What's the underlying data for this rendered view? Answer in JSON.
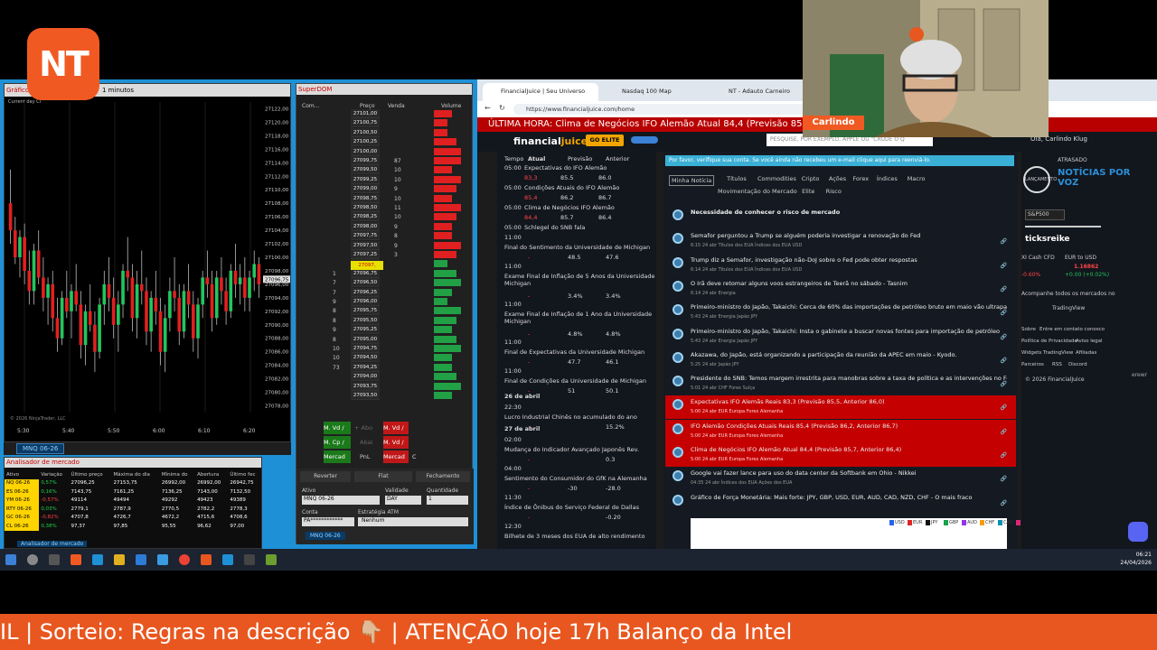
{
  "brand": {
    "logo_text": "NT",
    "accent": "#f05a22"
  },
  "chart": {
    "title": "Gráfico",
    "timeframe": "1 minutos",
    "label": "Current day Cl",
    "copyright": "© 2026 NinjaTrader, LLC",
    "price_labels": [
      "27122,00",
      "27120,00",
      "27118,00",
      "27116,00",
      "27114,00",
      "27112,00",
      "27110,00",
      "27108,00",
      "27106,00",
      "27104,00",
      "27102,00",
      "27100,00",
      "27098,00",
      "27096,00",
      "27094,00",
      "27092,00",
      "27090,00",
      "27088,00",
      "27086,00",
      "27084,00",
      "27082,00",
      "27080,00",
      "27078,00"
    ],
    "current_price": "27096,75",
    "time_labels": [
      "5:30",
      "5:40",
      "5:50",
      "6:00",
      "6:10",
      "6:20"
    ],
    "tab": "MNQ 06-26"
  },
  "chart_data": {
    "type": "candlestick",
    "ylim": [
      27077,
      27123
    ],
    "candles": [
      [
        27108,
        27113,
        27102,
        27104
      ],
      [
        27104,
        27106,
        27099,
        27100
      ],
      [
        27100,
        27104,
        27097,
        27103
      ],
      [
        27103,
        27105,
        27096,
        27098
      ],
      [
        27098,
        27101,
        27093,
        27095
      ],
      [
        27095,
        27102,
        27093,
        27101
      ],
      [
        27101,
        27104,
        27096,
        27097
      ],
      [
        27097,
        27100,
        27092,
        27094
      ],
      [
        27094,
        27097,
        27090,
        27096
      ],
      [
        27096,
        27098,
        27089,
        27091
      ],
      [
        27091,
        27094,
        27086,
        27088
      ],
      [
        27088,
        27095,
        27087,
        27094
      ],
      [
        27094,
        27098,
        27091,
        27092
      ],
      [
        27092,
        27096,
        27088,
        27095
      ],
      [
        27095,
        27099,
        27092,
        27093
      ],
      [
        27093,
        27095,
        27085,
        27087
      ],
      [
        27087,
        27093,
        27084,
        27092
      ],
      [
        27092,
        27096,
        27089,
        27090
      ],
      [
        27090,
        27092,
        27083,
        27086
      ],
      [
        27086,
        27094,
        27085,
        27093
      ],
      [
        27093,
        27098,
        27090,
        27096
      ],
      [
        27096,
        27100,
        27092,
        27094
      ],
      [
        27094,
        27097,
        27088,
        27090
      ],
      [
        27090,
        27095,
        27086,
        27093
      ],
      [
        27093,
        27099,
        27091,
        27098
      ],
      [
        27098,
        27103,
        27095,
        27097
      ],
      [
        27097,
        27099,
        27089,
        27091
      ],
      [
        27091,
        27098,
        27088,
        27096
      ],
      [
        27096,
        27101,
        27093,
        27095
      ],
      [
        27095,
        27097,
        27087,
        27089
      ],
      [
        27089,
        27095,
        27086,
        27094
      ],
      [
        27094,
        27098,
        27090,
        27092
      ],
      [
        27092,
        27094,
        27084,
        27086
      ],
      [
        27086,
        27093,
        27083,
        27091
      ],
      [
        27091,
        27097,
        27089,
        27095
      ],
      [
        27095,
        27100,
        27092,
        27094
      ],
      [
        27094,
        27096,
        27087,
        27089
      ],
      [
        27089,
        27096,
        27088,
        27095
      ],
      [
        27095,
        27099,
        27091,
        27093
      ],
      [
        27093,
        27095,
        27086,
        27088
      ],
      [
        27088,
        27094,
        27085,
        27093
      ],
      [
        27093,
        27098,
        27091,
        27097
      ],
      [
        27097,
        27101,
        27094,
        27096
      ],
      [
        27096,
        27098,
        27089,
        27091
      ],
      [
        27091,
        27098,
        27090,
        27097
      ],
      [
        27097,
        27100,
        27093,
        27095
      ],
      [
        27095,
        27097,
        27090,
        27092
      ],
      [
        27092,
        27099,
        27091,
        27098
      ],
      [
        27098,
        27102,
        27094,
        27096
      ],
      [
        27096,
        27099,
        27093,
        27097
      ],
      [
        27097,
        27100,
        27092,
        27094
      ],
      [
        27094,
        27098,
        27092,
        27097
      ],
      [
        27097,
        27101,
        27095,
        27099
      ],
      [
        27099,
        27100,
        27094,
        27096
      ]
    ]
  },
  "superdom": {
    "title": "SuperDOM",
    "headers": [
      "Com...",
      "Preço",
      "Venda",
      "Volume"
    ],
    "prices": [
      "27101,00",
      "27100,75",
      "27100,50",
      "27100,25",
      "27100,00",
      "27099,75",
      "27099,50",
      "27099,25",
      "27099,00",
      "27098,75",
      "27098,50",
      "27098,25",
      "27098,00",
      "27097,75",
      "27097,50",
      "27097,25",
      "27097,00",
      "27096,75",
      "27096,50",
      "27096,25",
      "27096,00",
      "27095,75",
      "27095,50",
      "27095,25",
      "27095,00",
      "27094,75",
      "27094,50",
      "27094,25",
      "27094,00",
      "27093,75",
      "27093,50"
    ],
    "sell": [
      "",
      "",
      "",
      "",
      "",
      "87",
      "10",
      "10",
      "9",
      "10",
      "11",
      "10",
      "9",
      "8",
      "9",
      "3",
      "",
      "",
      "",
      "",
      "",
      "",
      "",
      "",
      "",
      "",
      "",
      "",
      "",
      "",
      ""
    ],
    "buy": [
      "",
      "",
      "",
      "",
      "",
      "",
      "",
      "",
      "",
      "",
      "",
      "",
      "",
      "",
      "",
      "",
      "",
      "1",
      "7",
      "7",
      "9",
      "8",
      "8",
      "9",
      "8",
      "10",
      "10",
      "73",
      "",
      "",
      ""
    ],
    "highlight_price": "27097,",
    "highlight_qty": "3",
    "buttons": {
      "mkt_sell1": "M. Vd /",
      "above": "+ Abo",
      "mkt_buy": "M. Cp /",
      "below": "Abai",
      "market": "Mercad",
      "pnl": "PnL",
      "mkt_sell2": "M. Vd /",
      "mkt_sell3": "Mercad",
      "c": "C"
    },
    "reverse": "Reverter",
    "flat": "Flat",
    "close": "Fechamento",
    "ativo_label": "Ativo",
    "ativo_value": "MNQ 06-26",
    "validade_label": "Validade",
    "validade_value": "DAY",
    "qty_label": "Quantidade",
    "qty_value": "1",
    "conta_label": "Conta",
    "conta_value": "PA************",
    "atm_label": "Estratégia ATM",
    "atm_value": "Nenhum",
    "tab": "MNQ 06-26"
  },
  "analyzer": {
    "title": "Analisador de mercado",
    "headers": [
      "Ativo",
      "Variação",
      "Último preço",
      "Máxima do dia",
      "Mínima do",
      "Abertura",
      "Último fec"
    ],
    "rows": [
      [
        "NQ 06-26",
        "0,57%",
        "27096,25",
        "27153,75",
        "26992,00",
        "26992,00",
        "26942,75"
      ],
      [
        "ES 06-26",
        "0,16%",
        "7143,75",
        "7161,25",
        "7136,25",
        "7143,00",
        "7132,50"
      ],
      [
        "YM 06-26",
        "-0,57%",
        "49114",
        "49494",
        "49292",
        "49423",
        "49389"
      ],
      [
        "RTY 06-26",
        "0,03%",
        "2779,1",
        "2787,9",
        "2770,5",
        "2782,2",
        "2778,3"
      ],
      [
        "GC 06-26",
        "-0,82%",
        "4707,8",
        "4726,7",
        "4672,2",
        "4715,6",
        "4708,6"
      ],
      [
        "CL 06-26",
        "0,38%",
        "97,37",
        "97,85",
        "95,55",
        "96,62",
        "97,00"
      ]
    ],
    "tab": "Analisador de mercado"
  },
  "browser": {
    "tabs": [
      "FinancialJuice | Seu Universo Fina",
      "Nasdaq 100 Map",
      "NT - Adauto Carneiro"
    ],
    "url": "https://www.financialjuice.com/home",
    "breaking": "ÚLTIMA HORA: Clima de Negócios IFO Alemão Atual 84,4 (Previsão 85,7, Anterior 86,4)",
    "logo_a": "financial",
    "logo_b": "juice",
    "go_elite": "GO ELITE",
    "search_placeholder": "PESQUISE, POR EXEMPLO, APPLE OU \"CRUDE O Q",
    "user": "Olá, Carlindo Klug",
    "cal_headers": [
      "Tempo",
      "Atual",
      "Previsão",
      "Anterior"
    ],
    "cal_events": [
      {
        "time": "05:00",
        "name": "Expectativas do IFO Alemão",
        "atual": "83,3",
        "prev": "85.5",
        "ant": "86.0"
      },
      {
        "time": "05:00",
        "name": "Condições Atuais do IFO Alemão",
        "atual": "85,4",
        "prev": "86.2",
        "ant": "86.7"
      },
      {
        "time": "05:00",
        "name": "Clima de Negócios IFO Alemão",
        "atual": "84,4",
        "prev": "85.7",
        "ant": "86.4"
      },
      {
        "time": "05:00",
        "name": "Schlegel do SNB fala",
        "atual": "",
        "prev": "",
        "ant": ""
      },
      {
        "time": "11:00",
        "name": "Final do Sentimento da Universidade de Michigan",
        "atual": "-",
        "prev": "48.5",
        "ant": "47.6"
      },
      {
        "time": "11:00",
        "name": "Exame Final de Inflação de 5 Anos da Universidade Michigan",
        "atual": "-",
        "prev": "3.4%",
        "ant": "3.4%"
      },
      {
        "time": "11:00",
        "name": "Exame Final de Inflação de 1 Ano da Universidade Michigan",
        "atual": "-",
        "prev": "4.8%",
        "ant": "4.8%"
      },
      {
        "time": "11:00",
        "name": "Final de Expectativas da Universidade Michigan",
        "atual": "-",
        "prev": "47.7",
        "ant": "46.1"
      },
      {
        "time": "11:00",
        "name": "Final de Condições da Universidade de Michigan",
        "atual": "-",
        "prev": "51",
        "ant": "50.1"
      }
    ],
    "day2": "26 de abril",
    "day2_event": {
      "time": "22:30",
      "name": "Lucro Industrial Chinês no acumulado do ano",
      "atual": "-",
      "prev": "",
      "ant": "15.2%"
    },
    "day3": "27 de abril",
    "day3_events": [
      {
        "time": "02:00",
        "name": "Mudança do Indicador Avançado Japonês Rev.",
        "atual": "-",
        "prev": "",
        "ant": "0.3"
      },
      {
        "time": "04:00",
        "name": "Sentimento do Consumidor do GfK na Alemanha",
        "atual": "-",
        "prev": "-30",
        "ant": "-28.0"
      },
      {
        "time": "11:30",
        "name": "Índice de Ônibus do Serviço Federal de Dallas",
        "atual": "-",
        "prev": "",
        "ant": "-0.20"
      },
      {
        "time": "12:30",
        "name": "Bilhete de 3 meses dos EUA de alto rendimento",
        "atual": "",
        "prev": "",
        "ant": ""
      }
    ],
    "verify_msg": "Por favor, verifique sua conta. Se você ainda não recebeu um e-mail clique aqui para reenviá-lo.",
    "news_tabs": [
      "Minha Notícia",
      "Títulos",
      "Commodities",
      "Cripto",
      "Ações",
      "Forex",
      "Índices",
      "Macro",
      "Movimentação do Mercado",
      "Elite",
      "Risco"
    ],
    "news": [
      {
        "title": "Necessidade de conhecer o risco de mercado",
        "meta": "",
        "red": false
      },
      {
        "title": "Semafor perguntou a Trump se alguém poderia investigar a renovação do Fed",
        "meta": "6:15 24 abr  Títulos dos EUA  Índices dos EUA  USD",
        "red": false
      },
      {
        "title": "Trump diz a Semafor, investigação não-DoJ sobre o Fed pode obter respostas",
        "meta": "6:14 24 abr  Títulos dos EUA  Índices dos EUA  USD",
        "red": false
      },
      {
        "title": "O Irã deve retomar alguns voos estrangeiros de Teerã no sábado - Tasnim",
        "meta": "6:14 24 abr  Energia",
        "red": false
      },
      {
        "title": "Primeiro-ministro do Japão, Takaichi: Cerca de 60% das importações de petróleo bruto em maio vão ultrapassar Ormuz",
        "meta": "5:43 24 abr  Energia  Japão  JPY",
        "red": false
      },
      {
        "title": "Primeiro-ministro do Japão, Takaichi: Insta o gabinete a buscar novas fontes para importação de petróleo",
        "meta": "5:43 24 abr  Energia  Japão  JPY",
        "red": false
      },
      {
        "title": "Akazawa, do Japão, está organizando a participação da reunião da APEC em maio - Kyodo.",
        "meta": "5:25 24 abr  Japão  JPY",
        "red": false
      },
      {
        "title": "Presidente do SNB: Temos margem irrestrita para manobras sobre a taxa de política e as intervenções no Forex.",
        "meta": "5:01 24 abr  CHF  Forex  Suíça",
        "red": false
      },
      {
        "title": "Expectativas IFO Alemãs Reais 83,3 (Previsão 85,5, Anterior 86,0)",
        "meta": "5:00 24 abr  EUR  Europa  Forex  Alemanha",
        "red": true
      },
      {
        "title": "IFO Alemão Condições Atuais Reais 85,4 (Previsão 86,2, Anterior 86,7)",
        "meta": "5:00 24 abr  EUR  Europa  Forex  Alemanha",
        "red": true
      },
      {
        "title": "Clima de Negócios IFO Alemão Atual 84,4 (Previsão 85,7, Anterior 86,4)",
        "meta": "5:00 24 abr  EUR  Europa  Forex  Alemanha",
        "red": true
      },
      {
        "title": "Google vai fazer lance para uso do data center da Softbank em Ohio - Nikkei",
        "meta": "04:35 24 abr  Índices dos EUA  Ações dos EUA",
        "red": false
      },
      {
        "title": "Gráfico de Força Monetária: Mais forte: JPY, GBP, USD, EUR, AUD, CAD, NZD, CHF - O mais fraco",
        "meta": "",
        "red": false
      }
    ],
    "legend": [
      "USD",
      "EUR",
      "JPY",
      "GBP",
      "AUD",
      "CHF",
      "CAD",
      "NZD"
    ],
    "right": {
      "atrasado": "ATRASADO",
      "lancamento": "LANÇAMENTO",
      "noticias": "NOTÍCIAS POR VOZ",
      "symbol": "S&P500",
      "tickstrike": "ticksreike",
      "cash_cfd": "XI Cash CFD",
      "cash_val": "-0.60%",
      "eurusd": "EUR to USD",
      "eurusd_val": "1.16862",
      "eurusd_chg": "+0.00 (+0.02%)",
      "follow": "Acompanhe todos os mercados no",
      "tv": "TradingView",
      "links": [
        "Sobre",
        "Entre em contato conosco",
        "Política de Privacidade",
        "Aviso legal",
        "Widgets",
        "TradingView",
        "Afiliadas",
        "Parceiros",
        "RSS",
        "Discord"
      ],
      "copyright": "© 2026 FinancialJuice",
      "erewr": "erewr"
    }
  },
  "webcam": {
    "name": "Carlindo"
  },
  "taskbar": {
    "time": "06:21",
    "date": "24/04/2026"
  },
  "ticker": {
    "text": "IL | Sorteio: Regras na descrição 👇🏼 | ATENÇÃO hoje 17h Balanço da Intel"
  }
}
